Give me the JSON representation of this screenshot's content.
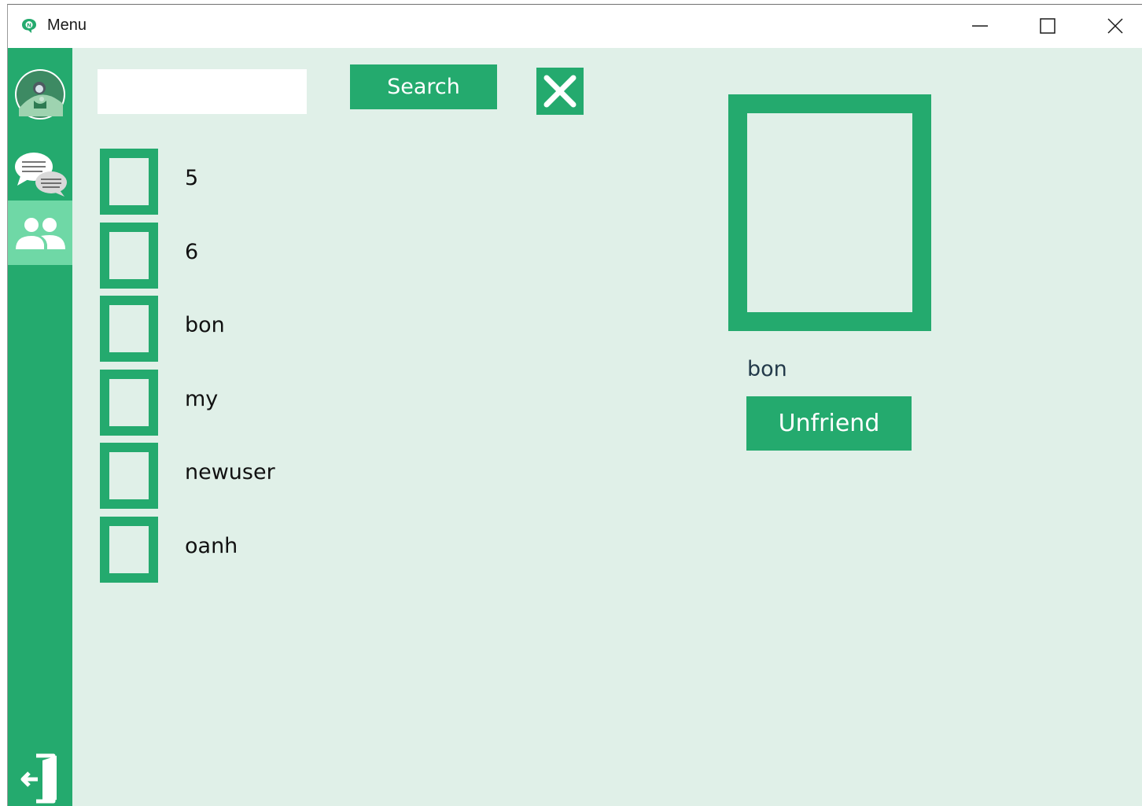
{
  "window": {
    "title": "Menu",
    "app_icon": "chat-bubble-icon"
  },
  "colors": {
    "accent": "#24aa6e",
    "accent_light": "#6fd8a6",
    "background": "#e0f0e8",
    "titlebar": "#ffffff"
  },
  "sidebar": {
    "items": [
      {
        "icon": "avatar-icon",
        "active": false
      },
      {
        "icon": "chat-icon",
        "active": false
      },
      {
        "icon": "friends-icon",
        "active": true
      },
      {
        "icon": "logout-icon",
        "active": false
      }
    ]
  },
  "search": {
    "value": "",
    "placeholder": "",
    "button_label": "Search",
    "clear_icon": "close-x-icon"
  },
  "friends": [
    {
      "name": "5"
    },
    {
      "name": "6"
    },
    {
      "name": "bon"
    },
    {
      "name": "my"
    },
    {
      "name": "newuser"
    },
    {
      "name": "oanh"
    }
  ],
  "detail": {
    "name": "bon",
    "unfriend_label": "Unfriend"
  }
}
